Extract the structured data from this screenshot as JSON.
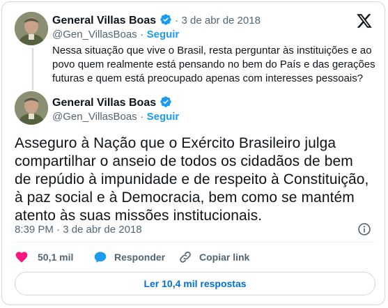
{
  "quoted_tweet": {
    "author_name": "General Villas Boas",
    "handle": "@Gen_VillasBoas",
    "separator": "·",
    "date": "3 de abr de 2018",
    "follow_label": "Seguir",
    "text": "Nessa situação que vive o Brasil, resta perguntar às instituições e ao povo quem realmente está pensando no bem do País e das gerações futuras e quem está preocupado apenas com interesses pessoais?"
  },
  "main_tweet": {
    "author_name": "General Villas Boas",
    "handle": "@Gen_VillasBoas",
    "separator": "·",
    "follow_label": "Seguir",
    "text": "Asseguro à Nação que o Exército Brasileiro julga compartilhar o anseio de todos os cidadãos de bem de repúdio à impunidade e de respeito à Constituição, à paz social e à Democracia, bem como se mantém atento às suas missões institucionais.",
    "timestamp": "8:39 PM · 3 de abr de 2018"
  },
  "actions": {
    "likes": "50,1 mil",
    "reply_label": "Responder",
    "copy_link_label": "Copiar link"
  },
  "replies_button_label": "Ler 10,4 mil respostas",
  "icons": {
    "platform": "x-logo-icon",
    "verified": "verified-badge-icon",
    "info": "info-icon",
    "like": "heart-icon",
    "reply": "speech-bubble-icon",
    "copy": "link-icon"
  },
  "colors": {
    "accent": "#1d9bf0",
    "like": "#f91880",
    "text": "#0f1419",
    "muted": "#536471"
  }
}
